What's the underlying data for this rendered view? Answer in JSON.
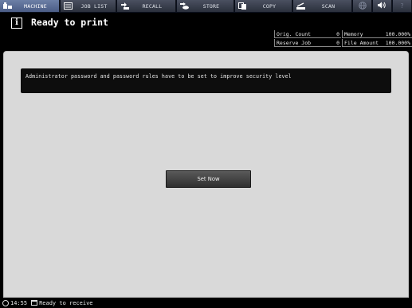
{
  "tabs": [
    {
      "key": "machine",
      "label": "MACHINE",
      "icon": "machine-icon",
      "active": true
    },
    {
      "key": "joblist",
      "label": "JOB LIST",
      "icon": "job-list-icon"
    },
    {
      "key": "recall",
      "label": "RECALL",
      "icon": "recall-icon"
    },
    {
      "key": "store",
      "label": "STORE",
      "icon": "store-icon"
    },
    {
      "key": "copy",
      "label": "COPY",
      "icon": "copy-icon"
    },
    {
      "key": "scan",
      "label": "SCAN",
      "icon": "scan-icon"
    },
    {
      "key": "globe",
      "label": "",
      "icon": "globe-icon"
    },
    {
      "key": "volume",
      "label": "",
      "icon": "volume-icon"
    },
    {
      "key": "help",
      "label": "?",
      "icon": "help-icon"
    }
  ],
  "header": {
    "title": "Ready to print",
    "info_glyph": "i"
  },
  "status": {
    "orig_count_label": "Orig. Count",
    "orig_count_value": "0",
    "memory_label": "Memory",
    "memory_value": "100.000%",
    "reserve_job_label": "Reserve Job",
    "reserve_job_value": "0",
    "file_amount_label": "File Amount",
    "file_amount_value": "100.000%"
  },
  "main": {
    "message": "Administrator password and password rules have to be set to improve security level",
    "set_now_label": "Set Now"
  },
  "footer": {
    "time": "14:55",
    "status": "Ready to receive"
  }
}
